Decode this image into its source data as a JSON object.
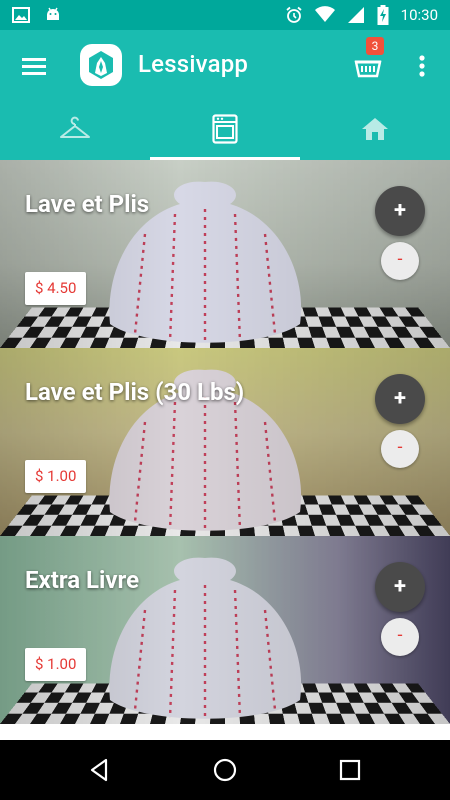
{
  "status_bar": {
    "time": "10:30",
    "icons": [
      "image-icon",
      "android-icon",
      "alarm-icon",
      "wifi-icon",
      "signal-icon",
      "battery-charging-icon"
    ]
  },
  "app_bar": {
    "title": "Lessivapp",
    "cart_count": "3",
    "icons": [
      "menu-icon",
      "app-logo-icon",
      "basket-icon",
      "more-vert-icon"
    ]
  },
  "tabs": [
    {
      "icon": "hanger-icon",
      "selected": false
    },
    {
      "icon": "washing-machine-icon",
      "selected": true
    },
    {
      "icon": "home-icon",
      "selected": false
    }
  ],
  "products": [
    {
      "name": "Lave et Plis",
      "price": "$ 4.50",
      "plus": "+",
      "minus": "-"
    },
    {
      "name": "Lave et Plis (30 Lbs)",
      "price": "$ 1.00",
      "plus": "+",
      "minus": "-"
    },
    {
      "name": "Extra Livre",
      "price": "$ 1.00",
      "plus": "+",
      "minus": "-"
    }
  ],
  "nav_bar": {
    "icons": [
      "back-icon",
      "home-circle-icon",
      "recents-icon"
    ]
  },
  "colors": {
    "primary": "#1abcb0",
    "status_bar": "#00a89b",
    "badge": "#f0513a",
    "price_text": "#e53935"
  }
}
